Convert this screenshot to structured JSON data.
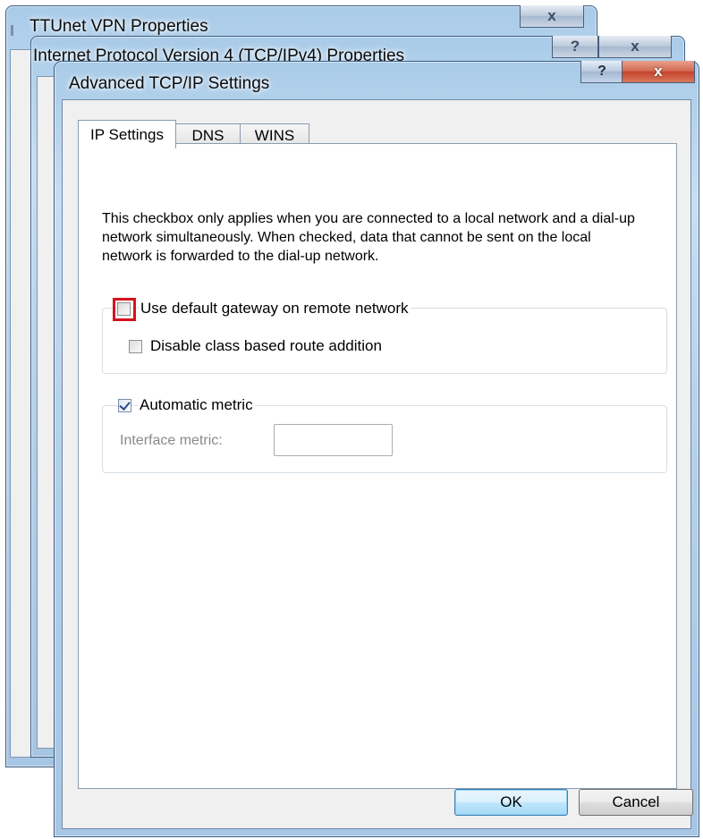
{
  "back_windows": [
    {
      "title": "TTUnet VPN Properties",
      "close_label": "x"
    },
    {
      "title": "Internet Protocol Version 4 (TCP/IPv4) Properties",
      "help_label": "?",
      "close_label": "x"
    }
  ],
  "dialog": {
    "title": "Advanced TCP/IP Settings",
    "help_label": "?",
    "close_label": "x"
  },
  "tabs": [
    {
      "label": "IP Settings",
      "active": true
    },
    {
      "label": "DNS",
      "active": false
    },
    {
      "label": "WINS",
      "active": false
    }
  ],
  "description": "This checkbox only applies when you are connected to a local network and a dial-up network simultaneously.  When checked, data that cannot be sent on the local network is forwarded to the dial-up network.",
  "gateway_group": {
    "use_default_gateway": {
      "label": "Use default gateway on remote network",
      "checked": false
    },
    "disable_class_route": {
      "label": "Disable class based route addition",
      "checked": false
    }
  },
  "metric_group": {
    "automatic_metric": {
      "label": "Automatic metric",
      "checked": true
    },
    "interface_metric": {
      "label": "Interface metric:",
      "value": ""
    }
  },
  "buttons": {
    "ok": "OK",
    "cancel": "Cancel"
  },
  "colors": {
    "highlight": "#d6121d",
    "glass": "#b6d2ec"
  }
}
